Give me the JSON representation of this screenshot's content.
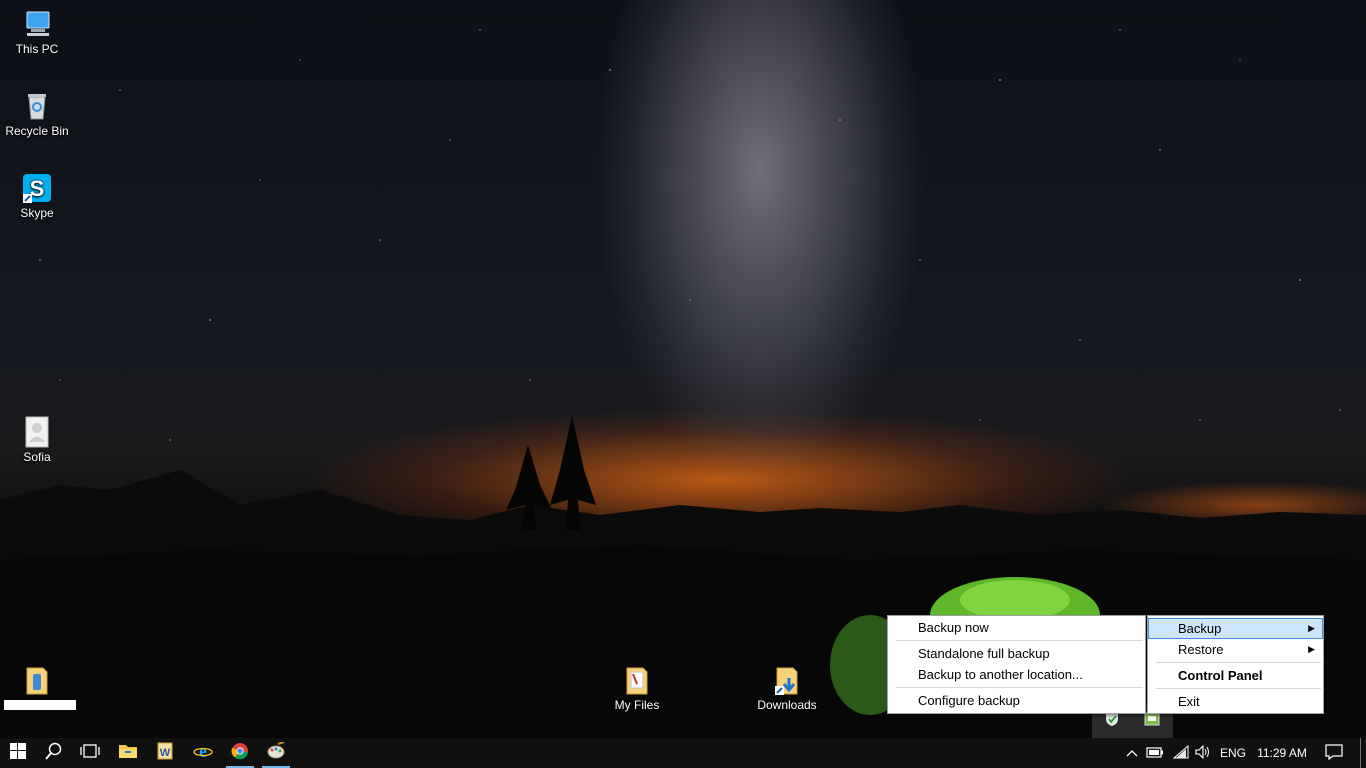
{
  "desktop": {
    "icons": {
      "this_pc": "This PC",
      "recycle_bin": "Recycle Bin",
      "skype": "Skype",
      "sofia": "Sofia",
      "my_files": "My Files",
      "downloads": "Downloads"
    }
  },
  "backup_menu": {
    "items": [
      "Backup now",
      "Standalone full backup",
      "Backup to another location...",
      "Configure backup"
    ]
  },
  "tray_menu": {
    "items": [
      "Backup",
      "Restore",
      "Control Panel",
      "Exit"
    ],
    "highlighted": "Backup",
    "submenu_arrow": "▶"
  },
  "taskbar": {
    "apps": [
      "start-icon",
      "search-icon",
      "task-view-icon",
      "file-explorer-icon",
      "word-icon",
      "internet-explorer-icon",
      "chrome-icon",
      "paint-icon"
    ],
    "tray": {
      "chevron": "^",
      "language": "ENG",
      "time": "11:29 AM"
    }
  },
  "colors": {
    "taskbar": "#101010",
    "menu_highlight": "#cde6fa",
    "accent": "#76b9ed"
  }
}
